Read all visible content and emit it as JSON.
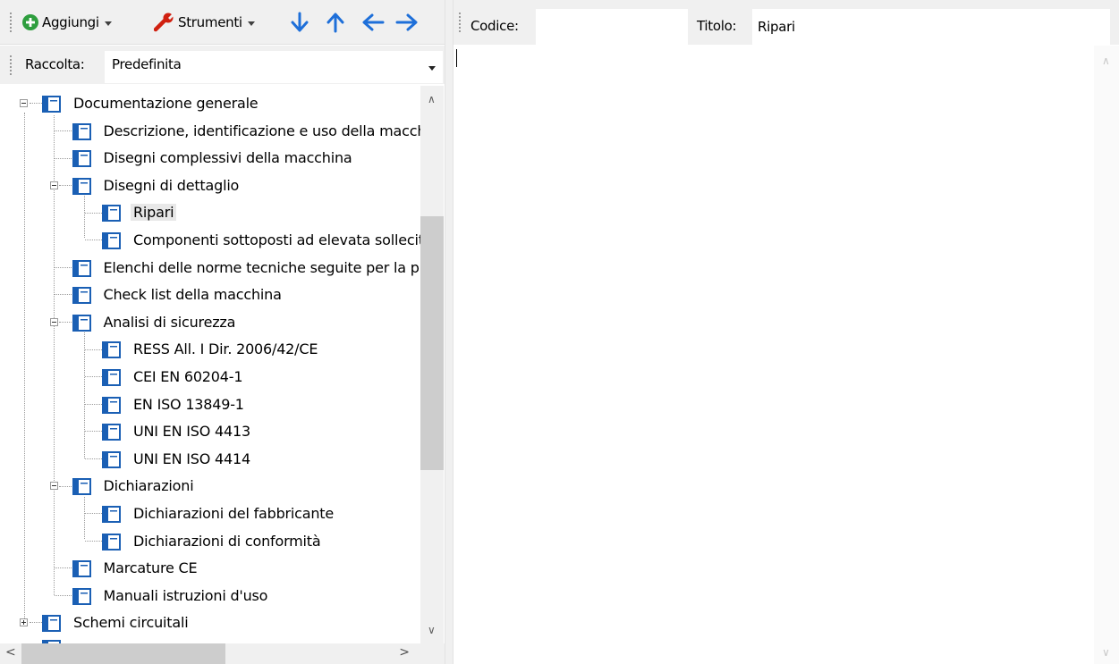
{
  "toolbar": {
    "add_label": "Aggiungi",
    "tools_label": "Strumenti",
    "icons": [
      "plus-circle-icon",
      "wrench-icon",
      "arrow-down-icon",
      "arrow-up-icon",
      "arrow-left-icon",
      "arrow-right-icon"
    ],
    "colors": {
      "add_green": "#2e9e3e",
      "wrench_red": "#d02010",
      "arrow_blue": "#1e6fd9"
    }
  },
  "collection": {
    "label": "Raccolta:",
    "value": "Predefinita"
  },
  "tree": {
    "nodes": [
      {
        "label": "Documentazione generale",
        "depth": 0,
        "expander": "minus"
      },
      {
        "label": "Descrizione, identificazione e uso della macchina",
        "depth": 1,
        "expander": ""
      },
      {
        "label": "Disegni complessivi della macchina",
        "depth": 1,
        "expander": ""
      },
      {
        "label": "Disegni di dettaglio",
        "depth": 1,
        "expander": "minus"
      },
      {
        "label": "Ripari",
        "depth": 2,
        "expander": "",
        "selected": true
      },
      {
        "label": "Componenti sottoposti ad elevata sollecitazione",
        "depth": 2,
        "expander": ""
      },
      {
        "label": "Elenchi delle norme tecniche seguite per la progettazione",
        "depth": 1,
        "expander": ""
      },
      {
        "label": "Check list della macchina",
        "depth": 1,
        "expander": ""
      },
      {
        "label": "Analisi di sicurezza",
        "depth": 1,
        "expander": "minus"
      },
      {
        "label": "RESS All. I Dir. 2006/42/CE",
        "depth": 2,
        "expander": ""
      },
      {
        "label": "CEI EN 60204-1",
        "depth": 2,
        "expander": ""
      },
      {
        "label": "EN ISO 13849-1",
        "depth": 2,
        "expander": ""
      },
      {
        "label": "UNI EN ISO 4413",
        "depth": 2,
        "expander": ""
      },
      {
        "label": "UNI EN ISO 4414",
        "depth": 2,
        "expander": ""
      },
      {
        "label": "Dichiarazioni",
        "depth": 1,
        "expander": "minus"
      },
      {
        "label": "Dichiarazioni del fabbricante",
        "depth": 2,
        "expander": ""
      },
      {
        "label": "Dichiarazioni di conformità",
        "depth": 2,
        "expander": ""
      },
      {
        "label": "Marcature CE",
        "depth": 1,
        "expander": ""
      },
      {
        "label": "Manuali istruzioni d'uso",
        "depth": 1,
        "expander": ""
      },
      {
        "label": "Schemi circuitali",
        "depth": 0,
        "expander": "plus"
      }
    ],
    "node_icon": "document-node-icon",
    "icon_color": "#1a5fb4"
  },
  "scrollbars": {
    "tree_vertical_position": 0.3,
    "tree_horizontal_position": 0.0
  },
  "header": {
    "codice_label": "Codice:",
    "codice_value": "",
    "titolo_label": "Titolo:",
    "titolo_value": "Ripari"
  },
  "editor": {
    "content": ""
  }
}
